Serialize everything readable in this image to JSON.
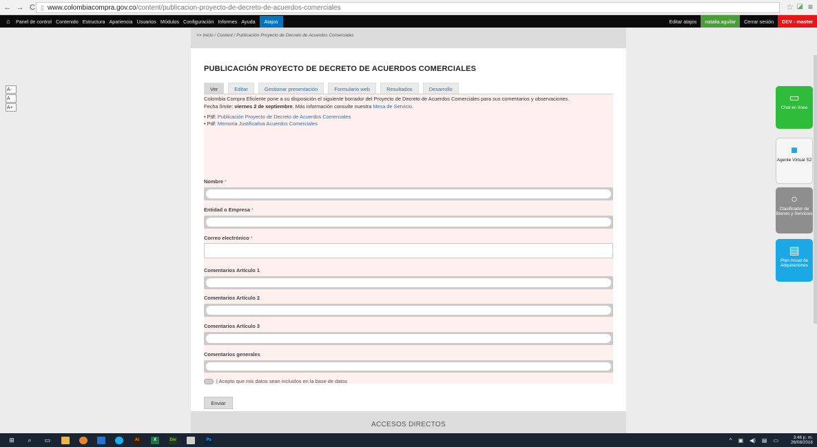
{
  "browser": {
    "url_domain": "www.colombiacompra.gov.co",
    "url_path": "/content/publicacion-proyecto-de-decreto-de-acuerdos-comerciales"
  },
  "admin_bar": {
    "items": [
      "Panel de control",
      "Contenido",
      "Estructura",
      "Apariencia",
      "Usuarios",
      "Módulos",
      "Configuración",
      "Informes",
      "Ayuda"
    ],
    "shortcuts": "Atajos",
    "edit_shortcuts": "Editar atajos",
    "user": "natalia.aguilar",
    "logout": "Cerrar sesión",
    "env": "DEV - master"
  },
  "breadcrumb": ">> Inicio / Content / Publicación Proyecto de Decreto de Acuerdos Comerciales",
  "title": "PUBLICACIÓN PROYECTO DE DECRETO DE ACUERDOS COMERCIALES",
  "tabs": [
    "Ver",
    "Editar",
    "Gestionar presentación",
    "Formulario web",
    "Resultados",
    "Desarrollo"
  ],
  "intro": {
    "text": "Colombia Compra Eficiente pone a su disposición el siguiente borrador del Proyecto de Decreto de Acuerdos Comerciales para sus comentarios y observaciones.",
    "deadline_label": "Fecha límite:",
    "deadline_value": "viernes 2 de septiembre",
    "more_info": ". Más información consulte nuestra",
    "service_link": "Mesa de Servicio",
    "doc_prefix": "Pdf:",
    "doc1": "Publicación Proyecto de Decreto de Acuerdos Comerciales",
    "doc2": "Memoria Justificativa Acuerdos Comerciales"
  },
  "form": {
    "nombre": "Nombre",
    "entidad": "Entidad o Empresa",
    "correo": "Correo electrónico",
    "art1": "Comentarios Artículo 1",
    "art2": "Comentarios Artículo 2",
    "art3": "Comentarios Artículo 3",
    "generales": "Comentarios generales",
    "required_mark": "*",
    "consent": "| Acepto que mis datos sean incluidos en la base de datos",
    "submit": "Enviar"
  },
  "footer": "ACCESOS DIRECTOS",
  "font_controls": [
    "A-",
    "A",
    "A+"
  ],
  "widgets": {
    "chat": "Chat en línea",
    "agent": "Agente Virtual S2",
    "classifier": "Clasificador de Bienes y Servicios",
    "plan": "Plan Anual de Adquisiciones"
  },
  "taskbar": {
    "time": "3:46 p. m.",
    "date": "26/08/2016"
  },
  "colors": {
    "admin_bg": "#0b0b0b",
    "shortcut_blue": "#0074bd",
    "user_green": "#4c9b3c",
    "dev_red": "#e3171a",
    "form_bg": "#fdf0ef",
    "link": "#3b6e9e",
    "widget_green": "#2ebc3a",
    "widget_gray": "#8e8e8e",
    "widget_cyan": "#1aa9e4"
  }
}
